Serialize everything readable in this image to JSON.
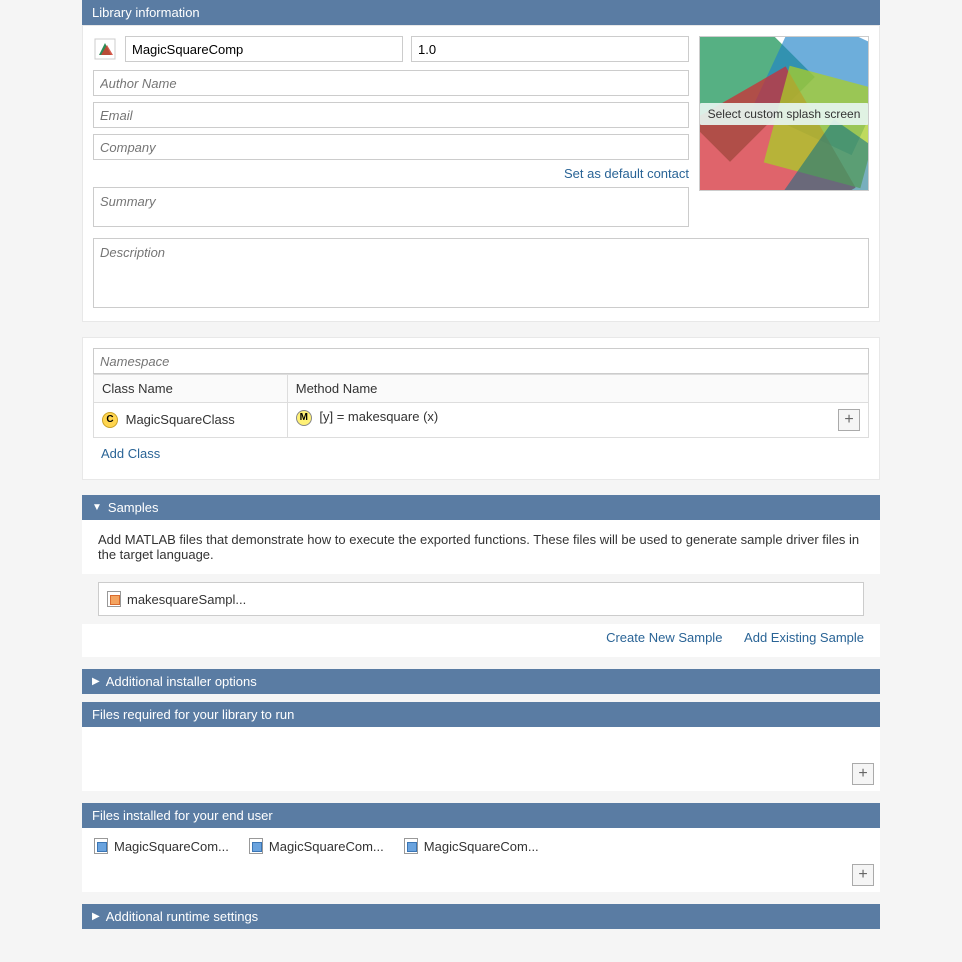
{
  "library": {
    "header": "Library information",
    "name": "MagicSquareComp",
    "version": "1.0",
    "author_placeholder": "Author Name",
    "email_placeholder": "Email",
    "company_placeholder": "Company",
    "set_default_contact": "Set as default contact",
    "summary_placeholder": "Summary",
    "description_placeholder": "Description",
    "splash_label": "Select custom splash screen"
  },
  "classes": {
    "namespace_placeholder": "Namespace",
    "col_class": "Class Name",
    "col_method": "Method Name",
    "class_name": "MagicSquareClass",
    "method_sig": "[y] = makesquare (x)",
    "add_class": "Add Class"
  },
  "samples": {
    "header": "Samples",
    "description": "Add MATLAB files that demonstrate how to execute the exported functions.  These files will be used to generate sample driver files in the target language.",
    "file": "makesquareSampl...",
    "create_new": "Create New Sample",
    "add_existing": "Add Existing Sample"
  },
  "installer": {
    "header": "Additional installer options"
  },
  "files_required": {
    "header": "Files required for your library to run"
  },
  "files_installed": {
    "header": "Files installed for your end user",
    "items": [
      "MagicSquareCom...",
      "MagicSquareCom...",
      "MagicSquareCom..."
    ]
  },
  "runtime": {
    "header": "Additional runtime settings"
  }
}
